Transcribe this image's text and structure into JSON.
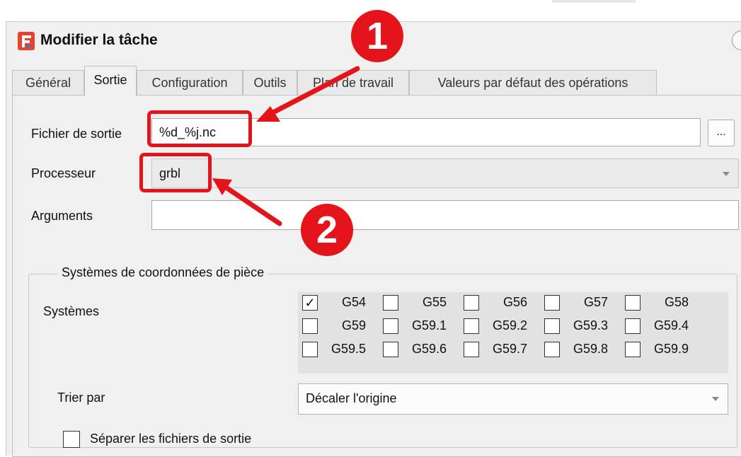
{
  "window": {
    "title": "Modifier la tâche"
  },
  "tabs": [
    {
      "label": "Général"
    },
    {
      "label": "Sortie"
    },
    {
      "label": "Configuration"
    },
    {
      "label": "Outils"
    },
    {
      "label": "Plan de travail"
    },
    {
      "label": "Valeurs par défaut des opérations"
    }
  ],
  "form": {
    "output_file": {
      "label": "Fichier de sortie",
      "value": "%d_%j.nc",
      "browse_label": "..."
    },
    "processor": {
      "label": "Processeur",
      "value": "grbl"
    },
    "arguments": {
      "label": "Arguments",
      "value": ""
    }
  },
  "coord_group": {
    "title": "Systèmes de coordonnées de pièce",
    "systems_label": "Systèmes",
    "systems": [
      {
        "label": "G54",
        "checked": true,
        "check_mark": "✓"
      },
      {
        "label": "G55",
        "checked": false
      },
      {
        "label": "G56",
        "checked": false
      },
      {
        "label": "G57",
        "checked": false
      },
      {
        "label": "G58",
        "checked": false
      },
      {
        "label": "G59",
        "checked": false
      },
      {
        "label": "G59.1",
        "checked": false
      },
      {
        "label": "G59.2",
        "checked": false
      },
      {
        "label": "G59.3",
        "checked": false
      },
      {
        "label": "G59.4",
        "checked": false
      },
      {
        "label": "G59.5",
        "checked": false
      },
      {
        "label": "G59.6",
        "checked": false
      },
      {
        "label": "G59.7",
        "checked": false
      },
      {
        "label": "G59.8",
        "checked": false
      },
      {
        "label": "G59.9",
        "checked": false
      }
    ],
    "sort_label": "Trier par",
    "sort_value": "Décaler l'origine",
    "separate_files": {
      "label": "Séparer les fichiers de sortie",
      "checked": false
    }
  },
  "annotations": {
    "badge_1": "1",
    "badge_2": "2",
    "color": "#e4141b"
  },
  "colors": {
    "logo_red": "#e8412f",
    "logo_blue": "#2b7fd1"
  }
}
